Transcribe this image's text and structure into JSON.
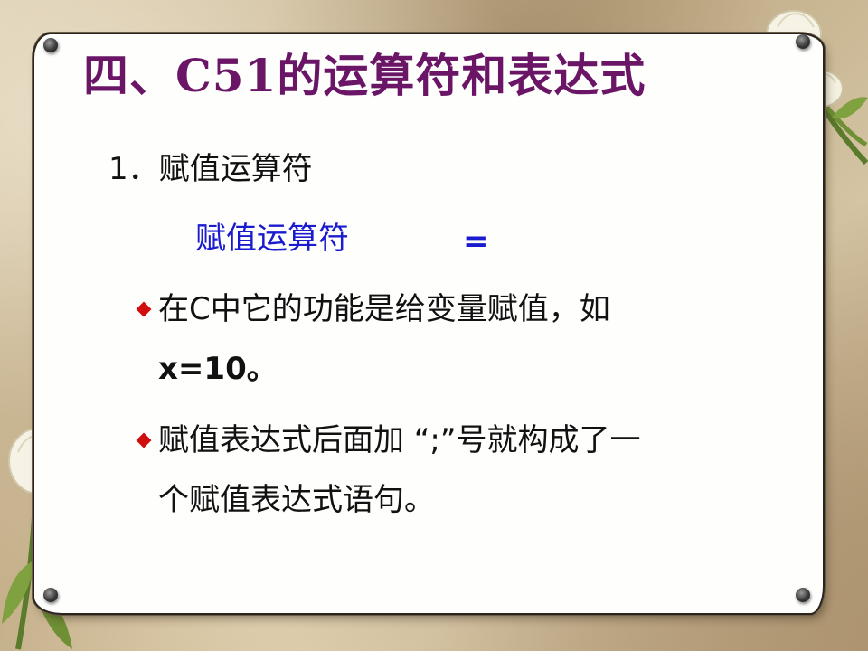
{
  "slide": {
    "title": "四、C51的运算符和表达式",
    "section_heading": "1．赋值运算符",
    "operator_label": "赋值运算符",
    "operator_symbol": "=",
    "bullets": [
      {
        "line1": "在C中它的功能是给变量赋值，如",
        "line2": "x=10。"
      },
      {
        "line1": "赋值表达式后面加 “;”号就构成了一",
        "line2": "个赋值表达式语句。"
      }
    ]
  },
  "colors": {
    "title": "#6a1566",
    "highlight": "#1a1acf",
    "bullet": "#d10d0d",
    "paper": "#fefefd"
  },
  "icons": {
    "bullet": "red-diamond-icon",
    "pins": "pushpin-icon",
    "decoration": "tulip-flower-icon"
  }
}
